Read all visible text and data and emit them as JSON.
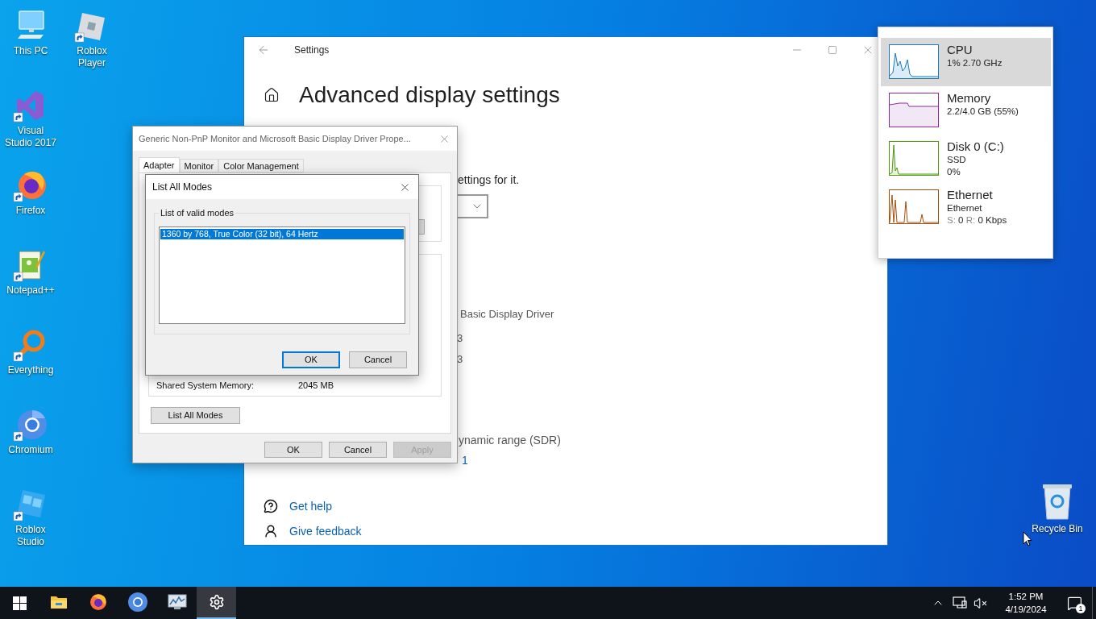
{
  "desktop": {
    "columns": [
      [
        {
          "label": "This PC",
          "kind": "computer"
        },
        {
          "label": "Visual Studio 2017",
          "kind": "visual-studio"
        },
        {
          "label": "Firefox",
          "kind": "firefox"
        },
        {
          "label": "Notepad++",
          "kind": "notepad"
        },
        {
          "label": "Everything",
          "kind": "everything"
        },
        {
          "label": "Chromium",
          "kind": "chromium"
        },
        {
          "label": "Roblox Studio",
          "kind": "roblox-studio"
        }
      ],
      [
        {
          "label": "Roblox Player",
          "kind": "roblox-player"
        }
      ]
    ],
    "recycle_bin": {
      "label": "Recycle Bin"
    }
  },
  "settings_window": {
    "title": "Settings",
    "heading": "Advanced display settings",
    "partial_intro": "ettings for it.",
    "partial_adapter": "Basic Display Driver",
    "partial_values": [
      "3",
      "3"
    ],
    "partial_color": "ynamic range (SDR)",
    "partial_link": "1",
    "links": [
      {
        "label": "Get help",
        "kind": "help"
      },
      {
        "label": "Give feedback",
        "kind": "feedback"
      }
    ]
  },
  "properties_dialog": {
    "title": "Generic Non-PnP Monitor and Microsoft Basic Display Driver Prope...",
    "tabs": [
      {
        "label": "Adapter",
        "selected": true
      },
      {
        "label": "Monitor",
        "selected": false
      },
      {
        "label": "Color Management",
        "selected": false
      }
    ],
    "shared_memory": {
      "label": "Shared System Memory:",
      "value": "2045 MB"
    },
    "list_modes_button": "List All Modes",
    "buttons": [
      {
        "label": "OK",
        "disabled": false
      },
      {
        "label": "Cancel",
        "disabled": false
      },
      {
        "label": "Apply",
        "disabled": true
      }
    ]
  },
  "list_modes_dialog": {
    "title": "List All Modes",
    "group_label": "List of valid modes",
    "modes": [
      {
        "label": "1360 by 768, True Color (32 bit), 64 Hertz",
        "selected": true
      }
    ],
    "buttons": [
      {
        "label": "OK",
        "default": true
      },
      {
        "label": "Cancel",
        "default": false
      }
    ]
  },
  "performance_panel": {
    "items": [
      {
        "kind": "cpu",
        "name": "CPU",
        "details": [
          "1% 2.70 GHz"
        ],
        "color": "#1b7bb8",
        "selected": true
      },
      {
        "kind": "memory",
        "name": "Memory",
        "details": [
          "2.2/4.0 GB (55%)"
        ],
        "color": "#8e2aa8",
        "selected": false
      },
      {
        "kind": "disk",
        "name": "Disk 0 (C:)",
        "details": [
          "SSD",
          "0%"
        ],
        "color": "#4d9a0e",
        "selected": false
      },
      {
        "kind": "ethernet",
        "name": "Ethernet",
        "details": [
          "Ethernet"
        ],
        "throughput": {
          "send_label": "S:",
          "send": "0",
          "receive_label": "R:",
          "receive": "0 Kbps"
        },
        "color": "#a4500c",
        "selected": false
      }
    ]
  },
  "taskbar": {
    "apps": [
      {
        "kind": "file-explorer",
        "active": false
      },
      {
        "kind": "firefox",
        "active": false
      },
      {
        "kind": "chromium",
        "active": false
      },
      {
        "kind": "task-manager",
        "active": false
      },
      {
        "kind": "settings",
        "active": true
      }
    ],
    "tray": {
      "time": "1:52 PM",
      "date": "4/19/2024",
      "notification_count": "1"
    }
  }
}
